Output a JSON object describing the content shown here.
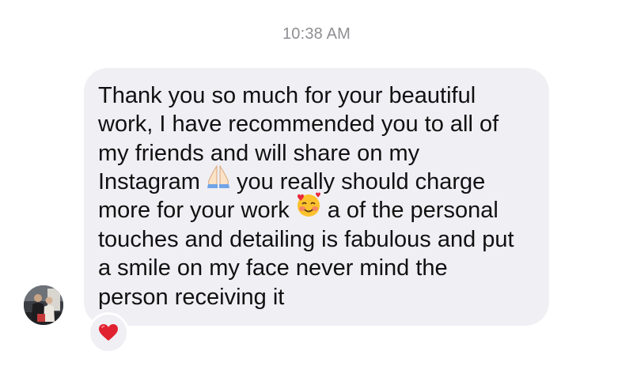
{
  "message": {
    "timestamp": "10:38 AM",
    "lines": [
      "Thank you so much for your beautiful",
      "work, I have recommended you to all of",
      "my friends and will share on my",
      {
        "before": "Instagram",
        "emoji": "folded-hands-emoji",
        "after": "you really should charge"
      },
      {
        "before": "more for your work",
        "emoji": "smiling-face-with-hearts-emoji",
        "after": "a of the personal"
      },
      "touches and detailing is fabulous and put",
      "a smile on my face never mind the",
      "person receiving it"
    ],
    "reaction": "red-heart-icon"
  },
  "sender": {
    "avatar": "contact-avatar"
  },
  "colors": {
    "bubble": "#efeff4",
    "text": "#111111",
    "timestamp": "#8e8e93",
    "heart": "#e0212f"
  }
}
